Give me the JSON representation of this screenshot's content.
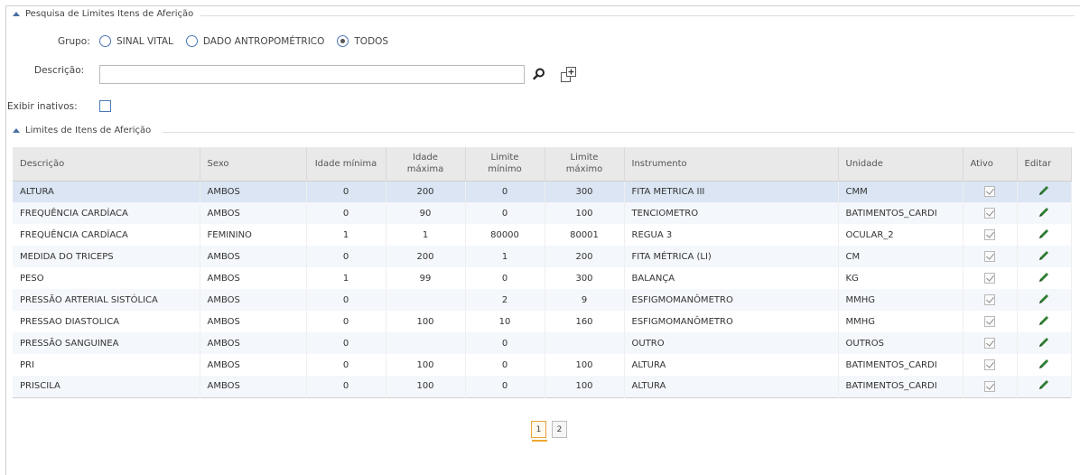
{
  "search_panel": {
    "title": "Pesquisa de Limites Itens de Aferição",
    "grupo_label": "Grupo:",
    "grupo_options": [
      "SINAL VITAL",
      "DADO ANTROPOMÉTRICO",
      "TODOS"
    ],
    "grupo_selected": "TODOS",
    "descricao_label": "Descrição:",
    "descricao_value": "",
    "exibir_inativos_label": "Exibir inativos:",
    "exibir_inativos_checked": false
  },
  "results_panel": {
    "title": "Limites de Itens de Aferição",
    "columns": [
      "Descrição",
      "Sexo",
      "Idade mínima",
      "Idade máxima",
      "Limite mínimo",
      "Limite máximo",
      "Instrumento",
      "Unidade",
      "Ativo",
      "Editar"
    ],
    "rows": [
      {
        "descricao": "ALTURA",
        "sexo": "AMBOS",
        "idade_min": "0",
        "idade_max": "200",
        "limite_min": "0",
        "limite_max": "300",
        "instrumento": "FITA METRICA III",
        "unidade": "CMM",
        "ativo": true
      },
      {
        "descricao": "FREQUÊNCIA CARDÍACA",
        "sexo": "AMBOS",
        "idade_min": "0",
        "idade_max": "90",
        "limite_min": "0",
        "limite_max": "100",
        "instrumento": "TENCIOMETRO",
        "unidade": "BATIMENTOS_CARDI",
        "ativo": true
      },
      {
        "descricao": "FREQUÊNCIA CARDÍACA",
        "sexo": "FEMININO",
        "idade_min": "1",
        "idade_max": "1",
        "limite_min": "80000",
        "limite_max": "80001",
        "instrumento": "REGUA 3",
        "unidade": "OCULAR_2",
        "ativo": true
      },
      {
        "descricao": "MEDIDA DO TRICEPS",
        "sexo": "AMBOS",
        "idade_min": "0",
        "idade_max": "200",
        "limite_min": "1",
        "limite_max": "200",
        "instrumento": "FITA MÉTRICA (LI)",
        "unidade": "CM",
        "ativo": true
      },
      {
        "descricao": "PESO",
        "sexo": "AMBOS",
        "idade_min": "1",
        "idade_max": "99",
        "limite_min": "0",
        "limite_max": "300",
        "instrumento": "BALANÇA",
        "unidade": "KG",
        "ativo": true
      },
      {
        "descricao": "PRESSÃO ARTERIAL SISTÓLICA",
        "sexo": "AMBOS",
        "idade_min": "0",
        "idade_max": "",
        "limite_min": "2",
        "limite_max": "9",
        "instrumento": "ESFIGMOMANÔMETRO",
        "unidade": "MMHG",
        "ativo": true
      },
      {
        "descricao": "PRESSAO DIASTOLICA",
        "sexo": "AMBOS",
        "idade_min": "0",
        "idade_max": "100",
        "limite_min": "10",
        "limite_max": "160",
        "instrumento": "ESFIGMOMANÔMETRO",
        "unidade": "MMHG",
        "ativo": true
      },
      {
        "descricao": "PRESSÃO SANGUINEA",
        "sexo": "AMBOS",
        "idade_min": "0",
        "idade_max": "",
        "limite_min": "0",
        "limite_max": "",
        "instrumento": "OUTRO",
        "unidade": "OUTROS",
        "ativo": true
      },
      {
        "descricao": "PRI",
        "sexo": "AMBOS",
        "idade_min": "0",
        "idade_max": "100",
        "limite_min": "0",
        "limite_max": "100",
        "instrumento": "ALTURA",
        "unidade": "BATIMENTOS_CARDI",
        "ativo": true
      },
      {
        "descricao": "PRISCILA",
        "sexo": "AMBOS",
        "idade_min": "0",
        "idade_max": "100",
        "limite_min": "0",
        "limite_max": "100",
        "instrumento": "ALTURA",
        "unidade": "BATIMENTOS_CARDI",
        "ativo": true
      }
    ],
    "selected_row": 0
  },
  "pagination": {
    "pages": [
      "1",
      "2"
    ],
    "current": "1"
  },
  "icons": {
    "search": "search-icon",
    "new_window": "new-window-icon",
    "edit": "pencil-icon",
    "collapse": "caret-up-icon"
  },
  "colors": {
    "accent": "#4a78b8",
    "edit_icon": "#2e7d32",
    "page_active": "#f0a830",
    "selected_row": "#dbe5f3"
  }
}
